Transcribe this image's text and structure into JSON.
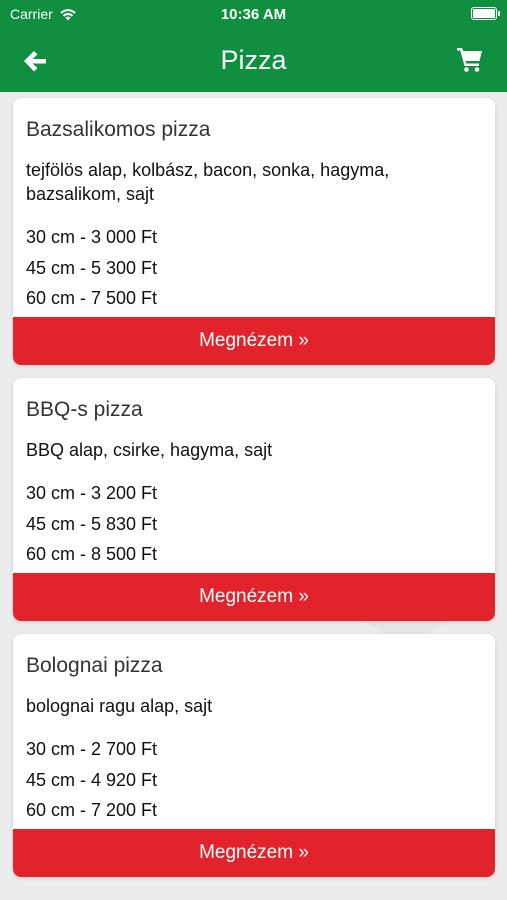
{
  "status": {
    "carrier": "Carrier",
    "time": "10:36 AM"
  },
  "nav": {
    "title": "Pizza"
  },
  "colors": {
    "header": "#0f8f3f",
    "button": "#e3232b"
  },
  "icons": {
    "back": "arrow-left-icon",
    "cart": "shopping-cart-icon",
    "wifi": "wifi-icon",
    "battery": "battery-icon"
  },
  "pizzas": [
    {
      "name": "Bazsalikomos pizza",
      "description": "tejfölös alap, kolbász, bacon, sonka, hagyma, bazsalikom, sajt",
      "prices": [
        "30 cm - 3 000 Ft",
        "45 cm - 5 300 Ft",
        "60 cm - 7 500 Ft"
      ],
      "button": "Megnézem »"
    },
    {
      "name": "BBQ-s pizza",
      "description": "BBQ alap, csirke, hagyma, sajt",
      "prices": [
        "30 cm - 3 200 Ft",
        "45 cm - 5 830 Ft",
        "60 cm - 8 500 Ft"
      ],
      "button": "Megnézem »"
    },
    {
      "name": "Bolognai pizza",
      "description": "bolognai ragu alap, sajt",
      "prices": [
        "30 cm - 2 700 Ft",
        "45 cm - 4 920 Ft",
        "60 cm - 7 200 Ft"
      ],
      "button": "Megnézem »"
    }
  ]
}
